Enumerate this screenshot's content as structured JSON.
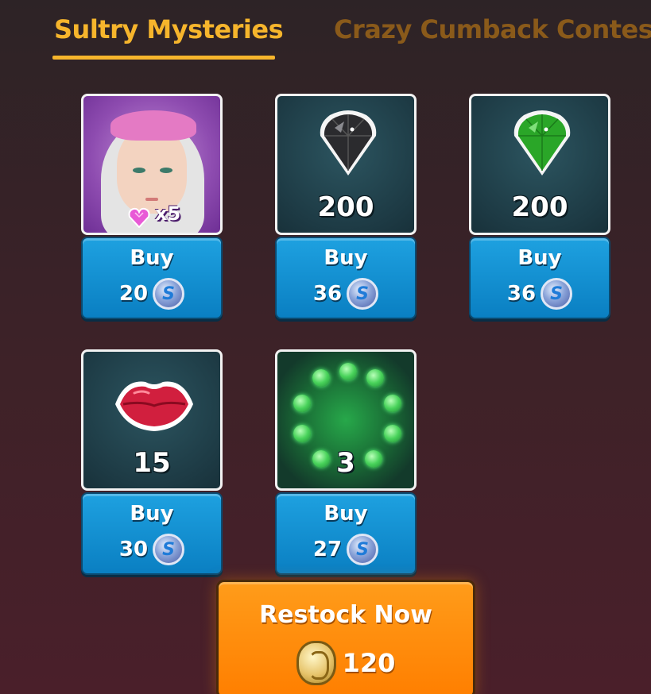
{
  "tabs": [
    {
      "label": "Sultry Mysteries",
      "active": true
    },
    {
      "label": "Crazy Cumback Contes",
      "active": false
    }
  ],
  "shop_items": [
    {
      "icon": "character-portrait",
      "quantity_label": "x5",
      "buy_label": "Buy",
      "price": "20",
      "currency_icon": "s-coin-icon"
    },
    {
      "icon": "black-gem-icon",
      "quantity_label": "200",
      "buy_label": "Buy",
      "price": "36",
      "currency_icon": "s-coin-icon"
    },
    {
      "icon": "green-gem-icon",
      "quantity_label": "200",
      "buy_label": "Buy",
      "price": "36",
      "currency_icon": "s-coin-icon"
    },
    {
      "icon": "lips-icon",
      "quantity_label": "15",
      "buy_label": "Buy",
      "price": "30",
      "currency_icon": "s-coin-icon"
    },
    {
      "icon": "clover-ring-icon",
      "quantity_label": "3",
      "buy_label": "Buy",
      "price": "27",
      "currency_icon": "s-coin-icon"
    }
  ],
  "restock": {
    "label": "Restock Now",
    "price": "120",
    "currency_icon": "gold-coin-icon"
  },
  "colors": {
    "tab_active": "#f6b52c",
    "tab_inactive": "#8a5a1a",
    "buy_button": "#0a7fc2",
    "restock_button": "#ff8a00"
  }
}
